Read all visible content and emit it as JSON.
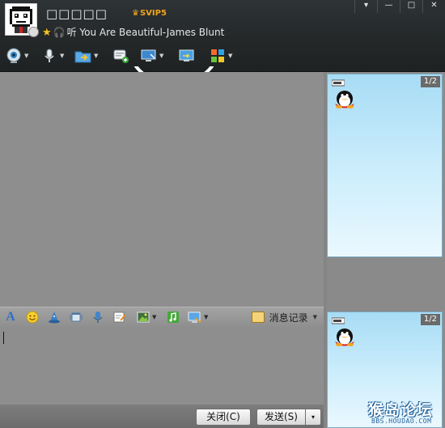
{
  "header": {
    "nickname": "□□□□□",
    "vip_badge": "SVIP5",
    "signature": "听 You  Are  Beautiful-James  Blunt",
    "window_buttons": {
      "menu": "▾",
      "minimize": "—",
      "maximize": "□",
      "close": "✕"
    }
  },
  "toolbar": {
    "items": [
      {
        "name": "video-call",
        "icon": "webcam-icon"
      },
      {
        "name": "voice-call",
        "icon": "microphone-icon"
      },
      {
        "name": "send-file",
        "icon": "folder-icon"
      },
      {
        "name": "send-sms",
        "icon": "sms-icon"
      },
      {
        "name": "remote-assist",
        "icon": "remote-desktop-icon"
      },
      {
        "name": "share-screen",
        "icon": "screen-share-icon"
      },
      {
        "name": "apps",
        "icon": "app-grid-icon"
      }
    ]
  },
  "ad_panel": {
    "page_indicator": "1/2"
  },
  "ad_panel_bottom": {
    "page_indicator": "1/2"
  },
  "input_toolbar": {
    "items": [
      "font-icon",
      "emoji-icon",
      "magic-icon",
      "shake-icon",
      "voice-message-icon",
      "scribble-icon",
      "picture-icon",
      "music-icon",
      "screenshot-icon"
    ],
    "history_label": "消息记录"
  },
  "buttons": {
    "close_label": "关闭(C)",
    "send_label": "发送(S)",
    "send_dropdown": "▾"
  },
  "watermark": {
    "title": "猴岛论坛",
    "url": "BBS.HOUDAO.COM"
  },
  "colors": {
    "header_bg": "#2e3336",
    "panel_bg": "#8e8e8e",
    "ad_bg": "#a7dcf5",
    "vip_gold": "#f2a51c"
  }
}
